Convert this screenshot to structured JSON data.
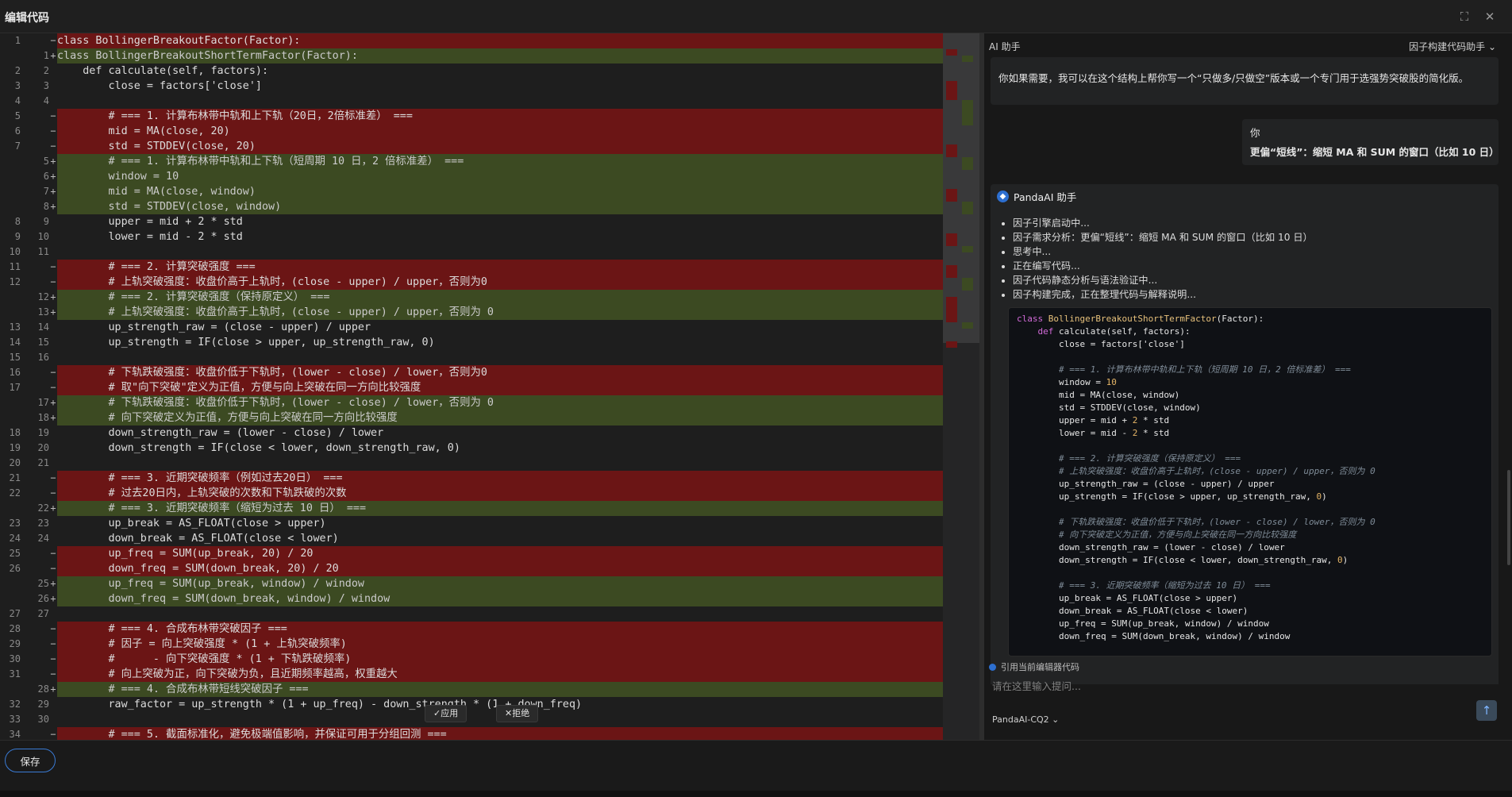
{
  "window": {
    "title": "编辑代码",
    "fullscreen_icon": "⛶",
    "close_icon": "✕"
  },
  "editor": {
    "lines": [
      {
        "t": "del",
        "o": "1",
        "n": "",
        "c": "class BollingerBreakoutFactor(Factor):"
      },
      {
        "t": "add",
        "o": "",
        "n": "1",
        "c": "class BollingerBreakoutShortTermFactor(Factor):"
      },
      {
        "t": "ctx",
        "o": "2",
        "n": "2",
        "c": "    def calculate(self, factors):"
      },
      {
        "t": "ctx",
        "o": "3",
        "n": "3",
        "c": "        close = factors['close']"
      },
      {
        "t": "ctx",
        "o": "4",
        "n": "4",
        "c": ""
      },
      {
        "t": "del",
        "o": "5",
        "n": "",
        "c": "        # === 1. 计算布林带中轨和上下轨（20日，2倍标准差） ==="
      },
      {
        "t": "del",
        "o": "6",
        "n": "",
        "c": "        mid = MA(close, 20)"
      },
      {
        "t": "del",
        "o": "7",
        "n": "",
        "c": "        std = STDDEV(close, 20)"
      },
      {
        "t": "add",
        "o": "",
        "n": "5",
        "c": "        # === 1. 计算布林带中轨和上下轨（短周期 10 日，2 倍标准差） ==="
      },
      {
        "t": "add",
        "o": "",
        "n": "6",
        "c": "        window = 10"
      },
      {
        "t": "add",
        "o": "",
        "n": "7",
        "c": "        mid = MA(close, window)"
      },
      {
        "t": "add",
        "o": "",
        "n": "8",
        "c": "        std = STDDEV(close, window)"
      },
      {
        "t": "ctx",
        "o": "8",
        "n": "9",
        "c": "        upper = mid + 2 * std"
      },
      {
        "t": "ctx",
        "o": "9",
        "n": "10",
        "c": "        lower = mid - 2 * std"
      },
      {
        "t": "ctx",
        "o": "10",
        "n": "11",
        "c": ""
      },
      {
        "t": "del",
        "o": "11",
        "n": "",
        "c": "        # === 2. 计算突破强度 ==="
      },
      {
        "t": "del",
        "o": "12",
        "n": "",
        "c": "        # 上轨突破强度：收盘价高于上轨时，(close - upper) / upper，否则为0"
      },
      {
        "t": "add",
        "o": "",
        "n": "12",
        "c": "        # === 2. 计算突破强度（保持原定义） ==="
      },
      {
        "t": "add",
        "o": "",
        "n": "13",
        "c": "        # 上轨突破强度：收盘价高于上轨时，(close - upper) / upper，否则为 0"
      },
      {
        "t": "ctx",
        "o": "13",
        "n": "14",
        "c": "        up_strength_raw = (close - upper) / upper"
      },
      {
        "t": "ctx",
        "o": "14",
        "n": "15",
        "c": "        up_strength = IF(close > upper, up_strength_raw, 0)"
      },
      {
        "t": "ctx",
        "o": "15",
        "n": "16",
        "c": ""
      },
      {
        "t": "del",
        "o": "16",
        "n": "",
        "c": "        # 下轨跌破强度：收盘价低于下轨时，(lower - close) / lower，否则为0"
      },
      {
        "t": "del",
        "o": "17",
        "n": "",
        "c": "        # 取\"向下突破\"定义为正值，方便与向上突破在同一方向比较强度"
      },
      {
        "t": "add",
        "o": "",
        "n": "17",
        "c": "        # 下轨跌破强度：收盘价低于下轨时，(lower - close) / lower，否则为 0"
      },
      {
        "t": "add",
        "o": "",
        "n": "18",
        "c": "        # 向下突破定义为正值，方便与向上突破在同一方向比较强度"
      },
      {
        "t": "ctx",
        "o": "18",
        "n": "19",
        "c": "        down_strength_raw = (lower - close) / lower"
      },
      {
        "t": "ctx",
        "o": "19",
        "n": "20",
        "c": "        down_strength = IF(close < lower, down_strength_raw, 0)"
      },
      {
        "t": "ctx",
        "o": "20",
        "n": "21",
        "c": ""
      },
      {
        "t": "del",
        "o": "21",
        "n": "",
        "c": "        # === 3. 近期突破频率（例如过去20日） ==="
      },
      {
        "t": "del",
        "o": "22",
        "n": "",
        "c": "        # 过去20日内，上轨突破的次数和下轨跌破的次数"
      },
      {
        "t": "add",
        "o": "",
        "n": "22",
        "c": "        # === 3. 近期突破频率（缩短为过去 10 日） ==="
      },
      {
        "t": "ctx",
        "o": "23",
        "n": "23",
        "c": "        up_break = AS_FLOAT(close > upper)"
      },
      {
        "t": "ctx",
        "o": "24",
        "n": "24",
        "c": "        down_break = AS_FLOAT(close < lower)"
      },
      {
        "t": "del",
        "o": "25",
        "n": "",
        "c": "        up_freq = SUM(up_break, 20) / 20"
      },
      {
        "t": "del",
        "o": "26",
        "n": "",
        "c": "        down_freq = SUM(down_break, 20) / 20"
      },
      {
        "t": "add",
        "o": "",
        "n": "25",
        "c": "        up_freq = SUM(up_break, window) / window"
      },
      {
        "t": "add",
        "o": "",
        "n": "26",
        "c": "        down_freq = SUM(down_break, window) / window"
      },
      {
        "t": "ctx",
        "o": "27",
        "n": "27",
        "c": ""
      },
      {
        "t": "del",
        "o": "28",
        "n": "",
        "c": "        # === 4. 合成布林带突破因子 ==="
      },
      {
        "t": "del",
        "o": "29",
        "n": "",
        "c": "        # 因子 = 向上突破强度 * (1 + 上轨突破频率)"
      },
      {
        "t": "del",
        "o": "30",
        "n": "",
        "c": "        #      - 向下突破强度 * (1 + 下轨跌破频率)"
      },
      {
        "t": "del",
        "o": "31",
        "n": "",
        "c": "        # 向上突破为正，向下突破为负，且近期频率越高，权重越大"
      },
      {
        "t": "add",
        "o": "",
        "n": "28",
        "c": "        # === 4. 合成布林带短线突破因子 ==="
      },
      {
        "t": "ctx",
        "o": "32",
        "n": "29",
        "c": "        raw_factor = up_strength * (1 + up_freq) - down_strength * (1 + down_freq)"
      },
      {
        "t": "ctx",
        "o": "33",
        "n": "30",
        "c": ""
      },
      {
        "t": "del",
        "o": "34",
        "n": "",
        "c": "        # === 5. 截面标准化，避免极端值影响，并保证可用于分组回测 ==="
      }
    ],
    "apply_label": "✓应用",
    "reject_label": "✕拒绝"
  },
  "ai_panel": {
    "label": "AI 助手",
    "assistant_select": "因子构建代码助手",
    "prev_message": "你如果需要，我可以在这个结构上帮你写一个“只做多/只做空”版本或一个专门用于选强势突破股的简化版。",
    "user_name": "你",
    "user_message": "更偏“短线”：缩短 MA 和 SUM 的窗口（比如 10 日）",
    "bot_name": "PandaAI 助手",
    "status_items": [
      "因子引擎启动中...",
      "因子需求分析：更偏“短线”：缩短 MA 和 SUM 的窗口（比如 10 日）",
      "思考中...",
      "正在编写代码...",
      "因子代码静态分析与语法验证中...",
      "因子构建完成，正在整理代码与解释说明..."
    ],
    "code_lines": [
      "class BollingerBreakoutShortTermFactor(Factor):",
      "    def calculate(self, factors):",
      "        close = factors['close']",
      "",
      "        # === 1. 计算布林带中轨和上下轨（短周期 10 日，2 倍标准差） ===",
      "        window = 10",
      "        mid = MA(close, window)",
      "        std = STDDEV(close, window)",
      "        upper = mid + 2 * std",
      "        lower = mid - 2 * std",
      "",
      "        # === 2. 计算突破强度（保持原定义） ===",
      "        # 上轨突破强度：收盘价高于上轨时，(close - upper) / upper，否则为 0",
      "        up_strength_raw = (close - upper) / upper",
      "        up_strength = IF(close > upper, up_strength_raw, 0)",
      "",
      "        # 下轨跌破强度：收盘价低于下轨时，(lower - close) / lower，否则为 0",
      "        # 向下突破定义为正值，方便与向上突破在同一方向比较强度",
      "        down_strength_raw = (lower - close) / lower",
      "        down_strength = IF(close < lower, down_strength_raw, 0)",
      "",
      "        # === 3. 近期突破频率（缩短为过去 10 日） ===",
      "        up_break = AS_FLOAT(close > upper)",
      "        down_break = AS_FLOAT(close < lower)",
      "        up_freq = SUM(up_break, window) / window",
      "        down_freq = SUM(down_break, window) / window"
    ],
    "reference_label": "引用当前编辑器代码",
    "input_placeholder": "请在这里输入提问...",
    "model": "PandaAI-CQ2",
    "send_icon": "↑"
  },
  "footer": {
    "save_label": "保存"
  },
  "colors": {
    "deleted_bg": "#6b1515",
    "added_bg": "#3c4a22",
    "accent": "#3a7bd5"
  }
}
